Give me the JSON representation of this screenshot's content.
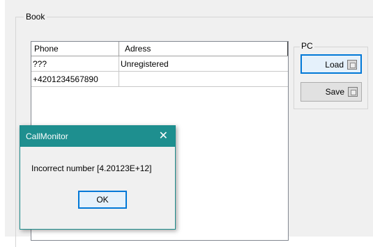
{
  "book": {
    "label": "Book",
    "columns": [
      "Phone",
      "Adress"
    ],
    "rows": [
      {
        "phone": "???",
        "address": "Unregistered"
      },
      {
        "phone": "+4201234567890",
        "address": ""
      }
    ]
  },
  "pc": {
    "label": "PC",
    "load_label": "Load",
    "save_label": "Save"
  },
  "dialog": {
    "title": "CallMonitor",
    "close_glyph": "✕",
    "message": "Incorrect number [4.20123E+12]",
    "ok_label": "OK"
  },
  "colors": {
    "dialog_titlebar": "#1e8f8f",
    "focus_border": "#0078d7"
  }
}
